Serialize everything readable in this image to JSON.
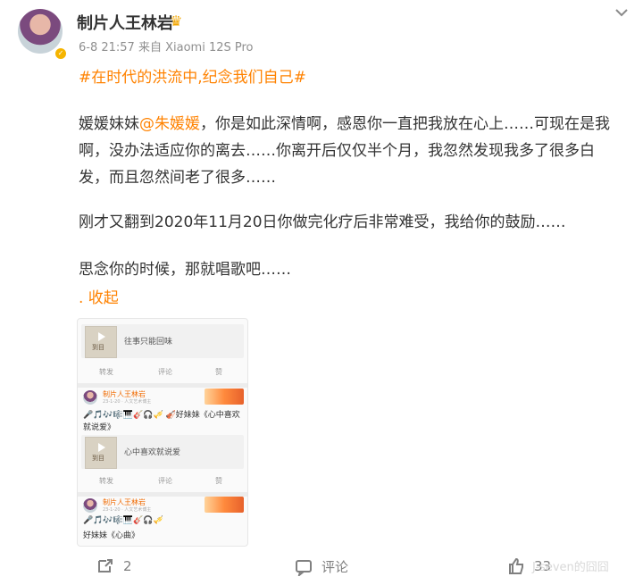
{
  "post": {
    "author": "制片人王林岩",
    "timestamp": "6-8 21:57",
    "source": "来自 Xiaomi 12S Pro",
    "topic": "#在时代的洪流中,纪念我们自己#",
    "para1_before": "媛媛妹妹",
    "mention": "@朱媛媛",
    "para1_after": "，你是如此深情啊，感恩你一直把我放在心上……可现在是我啊，没办法适应你的离去……你离开后仅仅半个月，我忽然发现我多了很多白发，而且忽然间老了很多……",
    "para2": "刚才又翻到2020年11月20日你做完化疗后非常难受，我给你的鼓励……",
    "para3": "思念你的时候，那就唱歌吧……",
    "collapse": ". 收起"
  },
  "screenshot": {
    "music1_title": "往事只能回味",
    "album_mark": "到目",
    "repost": "转发",
    "comment": "评论",
    "like": "赞",
    "mini_author": "制片人王林岩",
    "mini_meta1": "23-1-20 · 人文艺术博主",
    "mini_meta2": "23-1-20 · 人文艺术博主",
    "mini_text1_line1": "🎤🎵🎶🎼🎹🎸🎧🎺 🎻好妹妹《心中喜欢",
    "mini_text1_line2": "就说爱》",
    "music2_title": "心中喜欢就说爱",
    "mini_text2_line1": "🎤🎵🎶🎼🎹🎸🎧🎺",
    "mini_text2_line2": "好妹妹《心曲》"
  },
  "footer": {
    "repost_count": "2",
    "comment_label": "评论",
    "like_count": "33",
    "watermark": "J-seven的囧囧"
  },
  "colors": {
    "accent": "#ff8200",
    "text": "#333333",
    "muted": "#8f8f8f"
  }
}
